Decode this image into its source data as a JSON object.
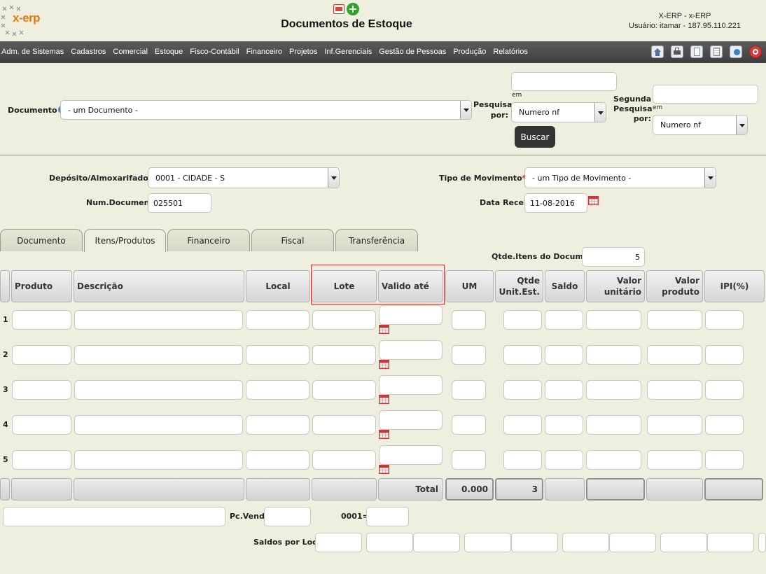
{
  "header": {
    "title": "Documentos de Estoque",
    "system": "X-ERP - x-ERP",
    "user": "Usuário: itamar - 187.95.110.221",
    "logo_text": "x-erp"
  },
  "menu": [
    "Adm. de Sistemas",
    "Cadastros",
    "Comercial",
    "Estoque",
    "Fisco-Contábil",
    "Financeiro",
    "Projetos",
    "Inf.Gerenciais",
    "Gestão de Pessoas",
    "Produção",
    "Relatórios"
  ],
  "search": {
    "documento_label": "Documento",
    "documento_select": "- um Documento -",
    "pesquisar_label": "Pesquisar por:",
    "em_label": "em",
    "pesquisar_select": "Numero nf",
    "buscar_label": "Buscar",
    "segunda_label": "Segunda Pesquisa por:",
    "segunda_em_label": "em",
    "segunda_select": "Numero nf"
  },
  "form": {
    "deposito_label": "Depósito/Almoxarifado",
    "deposito_value": "0001 - CIDADE - S",
    "tipo_label": "Tipo de Movimento",
    "tipo_value": "- um Tipo de Movimento -",
    "numdoc_label": "Num.Documento",
    "numdoc_value": "025501",
    "data_label": "Data Receb.",
    "data_value": "11-08-2016",
    "required_mark": "*"
  },
  "tabs": [
    "Documento",
    "Itens/Produtos",
    "Financeiro",
    "Fiscal",
    "Transferência"
  ],
  "active_tab": "Itens/Produtos",
  "items": {
    "qtde_label": "Qtde.Itens do Documento",
    "qtde_value": "5",
    "columns": [
      "Produto",
      "Descrição",
      "Local",
      "Lote",
      "Valido até",
      "UM",
      "Qtde Unit.Est.",
      "Saldo",
      "Valor unitário",
      "Valor produto",
      "IPI(%)"
    ],
    "rows": [
      "1",
      "2",
      "3",
      "4",
      "5"
    ],
    "total_label": "Total",
    "total_um": "0.000",
    "total_qtde": "3"
  },
  "footer": {
    "pcvenda_label": "Pc.Venda",
    "code_label": "0001=",
    "saldos_label": "Saldos por Local"
  },
  "colors": {
    "menubar": "#4a4a4a",
    "background": "#efefdf",
    "highlight": "#cc3333"
  }
}
